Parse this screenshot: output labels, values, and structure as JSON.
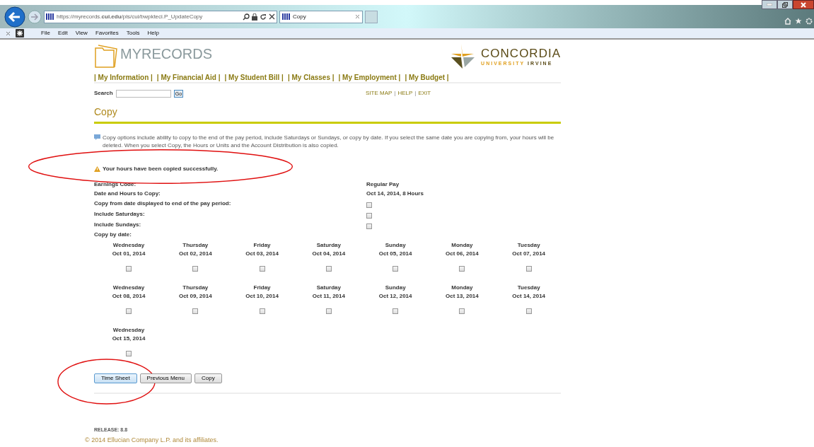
{
  "browser": {
    "url": "https://myrecords.**cui.edu**/pls/cui/bwpkteci.P_UpdateCopy",
    "tab_title": "Copy",
    "menu": [
      "File",
      "Edit",
      "View",
      "Favorites",
      "Tools",
      "Help"
    ]
  },
  "header": {
    "logo_text": "MYRECORDS",
    "university_name": "CONCORDIA",
    "university_sub": [
      "UNIVERSITY",
      "IRVINE"
    ]
  },
  "nav": [
    "| My Information |",
    "| My Financial Aid |",
    "| My Student Bill |",
    "| My Classes |",
    "| My Employment |",
    "| My Budget |"
  ],
  "search": {
    "label": "Search",
    "button": "Go"
  },
  "utility_links": [
    "SITE MAP",
    "HELP",
    "EXIT"
  ],
  "utility_separator": "|",
  "page_title": "Copy",
  "info_text": "Copy options include ability to copy to the end of the pay period, include Saturdays or Sundays, or copy by date. If you select the same date you are copying from, your hours will be deleted. When you select Copy, the Hours or Units and the Account Distribution is also copied.",
  "message": {
    "text": "Your hours have been copied successfully.",
    "circled": true
  },
  "fields": [
    {
      "label": "Earnings Code:",
      "kind": "text",
      "value": "Regular Pay"
    },
    {
      "label": "Date and Hours to Copy:",
      "kind": "text",
      "value": "Oct 14, 2014, 8 Hours"
    },
    {
      "label": "Copy from date displayed to end of the pay period:",
      "kind": "checkbox",
      "checked": false
    },
    {
      "label": "Include Saturdays:",
      "kind": "checkbox",
      "checked": false
    },
    {
      "label": "Include Sundays:",
      "kind": "checkbox",
      "checked": false
    }
  ],
  "copy_by_date": {
    "label": "Copy by date:",
    "days": [
      {
        "weekday": "Wednesday",
        "date": "Oct 01, 2014",
        "checked": false
      },
      {
        "weekday": "Thursday",
        "date": "Oct 02, 2014",
        "checked": false
      },
      {
        "weekday": "Friday",
        "date": "Oct 03, 2014",
        "checked": false
      },
      {
        "weekday": "Saturday",
        "date": "Oct 04, 2014",
        "checked": false
      },
      {
        "weekday": "Sunday",
        "date": "Oct 05, 2014",
        "checked": false
      },
      {
        "weekday": "Monday",
        "date": "Oct 06, 2014",
        "checked": false
      },
      {
        "weekday": "Tuesday",
        "date": "Oct 07, 2014",
        "checked": false
      },
      {
        "weekday": "Wednesday",
        "date": "Oct 08, 2014",
        "checked": false
      },
      {
        "weekday": "Thursday",
        "date": "Oct 09, 2014",
        "checked": false
      },
      {
        "weekday": "Friday",
        "date": "Oct 10, 2014",
        "checked": false
      },
      {
        "weekday": "Saturday",
        "date": "Oct 11, 2014",
        "checked": false
      },
      {
        "weekday": "Sunday",
        "date": "Oct 12, 2014",
        "checked": false
      },
      {
        "weekday": "Monday",
        "date": "Oct 13, 2014",
        "checked": false
      },
      {
        "weekday": "Tuesday",
        "date": "Oct 14, 2014",
        "checked": false
      },
      {
        "weekday": "Wednesday",
        "date": "Oct 15, 2014",
        "checked": false
      }
    ]
  },
  "buttons": [
    {
      "label": "Time Sheet",
      "circled": true
    },
    {
      "label": "Previous Menu",
      "circled": false
    },
    {
      "label": "Copy",
      "circled": false
    }
  ],
  "release": "RELEASE: 8.8",
  "copyright": "© 2014 Ellucian Company L.P. and its affiliates."
}
